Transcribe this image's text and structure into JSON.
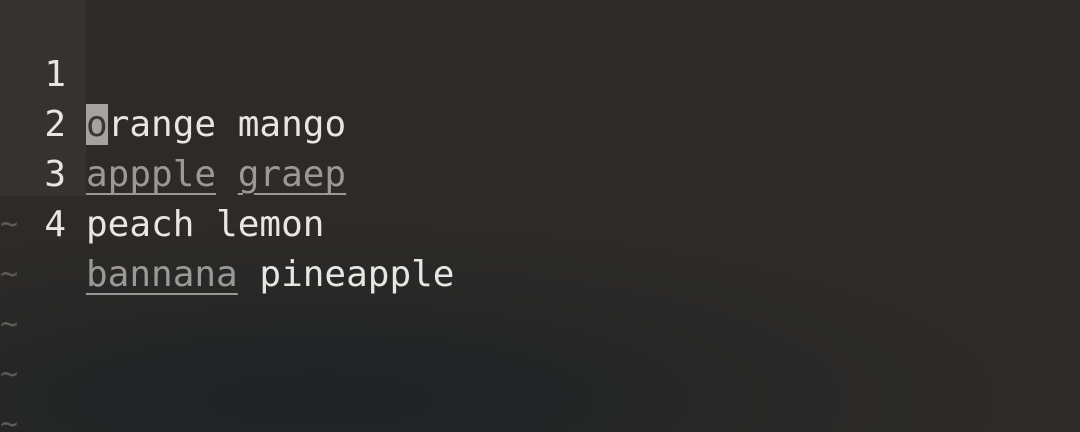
{
  "editor": {
    "lines": [
      {
        "number": "1",
        "cursor_char": "o",
        "words": [
          {
            "text": "range",
            "misspelled": false
          },
          {
            "text": " ",
            "misspelled": false
          },
          {
            "text": "mango",
            "misspelled": false
          }
        ]
      },
      {
        "number": "2",
        "words": [
          {
            "text": "appple",
            "misspelled": true
          },
          {
            "text": " ",
            "misspelled": false
          },
          {
            "text": "graep",
            "misspelled": true
          }
        ]
      },
      {
        "number": "3",
        "words": [
          {
            "text": "peach",
            "misspelled": false
          },
          {
            "text": " ",
            "misspelled": false
          },
          {
            "text": "lemon",
            "misspelled": false
          }
        ]
      },
      {
        "number": "4",
        "words": [
          {
            "text": "bannana",
            "misspelled": true
          },
          {
            "text": " ",
            "misspelled": false
          },
          {
            "text": "pineapple",
            "misspelled": false
          }
        ]
      }
    ],
    "empty_line_marker": "~"
  }
}
